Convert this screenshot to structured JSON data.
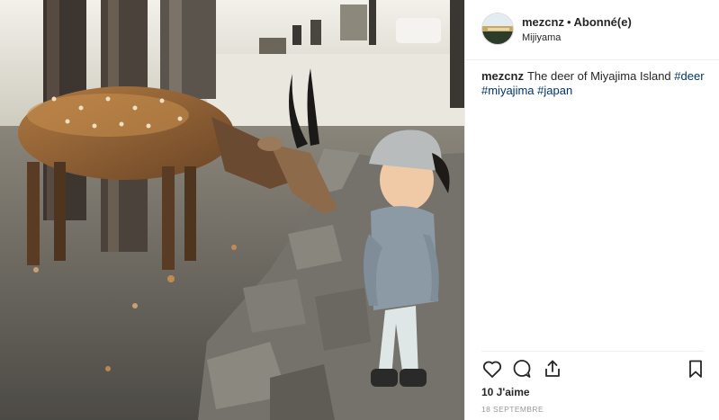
{
  "post": {
    "image_alt": "Child with cap facing a sika deer beside a stone wall",
    "header": {
      "username": "mezcnz",
      "separator": "•",
      "follow_status": "Abonné(e)",
      "location": "Mijiyama"
    },
    "caption": {
      "username": "mezcnz",
      "text": "The deer of Miyajima Island",
      "hashtags": [
        "#deer",
        "#miyajima",
        "#japan"
      ]
    },
    "actions": {
      "icons": [
        "heart-icon",
        "comment-icon",
        "share-icon",
        "bookmark-icon"
      ]
    },
    "likes": "10 J'aime",
    "date": "18 SEPTEMBRE"
  },
  "colors": {
    "text": "#262626",
    "hashtag": "#003569",
    "muted": "#999999",
    "border": "#efefef"
  }
}
